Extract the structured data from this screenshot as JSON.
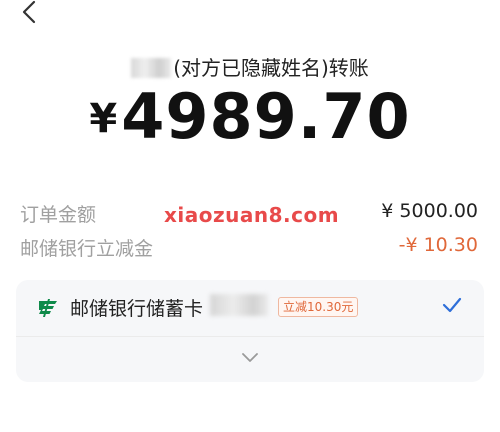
{
  "header": {
    "back_icon": "chevron-left-icon"
  },
  "payee": {
    "masked_name_suffix": "(对方已隐藏姓名)转账"
  },
  "payment": {
    "currency_symbol": "¥",
    "amount": "4989.70"
  },
  "details": {
    "order_amount_label": "订单金额",
    "order_amount_value": "¥ 5000.00",
    "discount_label": "邮储银行立减金",
    "discount_value": "-¥ 10.30"
  },
  "watermark": {
    "text": "xiaozuan8.com",
    "color": "#e84a4a"
  },
  "payment_method": {
    "bank_icon": "postal-savings-bank-logo-icon",
    "bank_name": "邮储银行储蓄卡",
    "promo_tag": "立减10.30元",
    "selected_icon": "checkmark-icon",
    "expand_icon": "chevron-down-icon"
  },
  "colors": {
    "discount": "#e0683a",
    "check": "#2f6fd9",
    "bank_logo": "#0f8a4a",
    "card_bg": "#f6f7f9"
  }
}
